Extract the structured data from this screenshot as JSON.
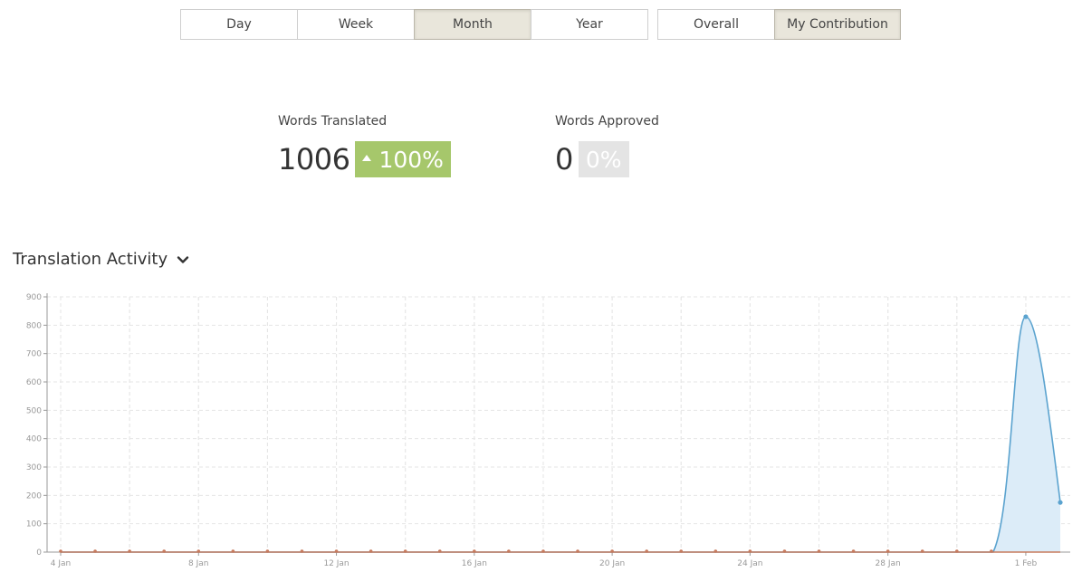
{
  "period_tabs": [
    {
      "label": "Day",
      "active": false
    },
    {
      "label": "Week",
      "active": false
    },
    {
      "label": "Month",
      "active": true
    },
    {
      "label": "Year",
      "active": false
    }
  ],
  "scope_tabs": [
    {
      "label": "Overall",
      "active": false
    },
    {
      "label": "My Contribution",
      "active": true
    }
  ],
  "stats": {
    "translated": {
      "label": "Words Translated",
      "value": "1006",
      "change": "100%",
      "direction": "up"
    },
    "approved": {
      "label": "Words Approved",
      "value": "0",
      "change": "0%",
      "direction": "none"
    }
  },
  "activity": {
    "title": "Translation Activity",
    "toggle_icon": "chevron-down-icon"
  },
  "colors": {
    "active_tab_bg": "#e9e6db",
    "increase_badge": "#a6c76b",
    "neutral_badge": "#e4e4e4",
    "translated_series": "#5ba3cf",
    "translated_fill": "#dcecf8",
    "approved_series": "#c77b5e"
  },
  "chart_data": {
    "type": "area",
    "title": "",
    "xlabel": "",
    "ylabel": "",
    "ylim": [
      0,
      900
    ],
    "yticks": [
      0,
      100,
      200,
      300,
      400,
      500,
      600,
      700,
      800,
      900
    ],
    "x_tick_labels": [
      "4 Jan",
      "8 Jan",
      "12 Jan",
      "16 Jan",
      "20 Jan",
      "24 Jan",
      "28 Jan",
      "1 Feb"
    ],
    "grid": true,
    "x": [
      "4 Jan",
      "5 Jan",
      "6 Jan",
      "7 Jan",
      "8 Jan",
      "9 Jan",
      "10 Jan",
      "11 Jan",
      "12 Jan",
      "13 Jan",
      "14 Jan",
      "15 Jan",
      "16 Jan",
      "17 Jan",
      "18 Jan",
      "19 Jan",
      "20 Jan",
      "21 Jan",
      "22 Jan",
      "23 Jan",
      "24 Jan",
      "25 Jan",
      "26 Jan",
      "27 Jan",
      "28 Jan",
      "29 Jan",
      "30 Jan",
      "31 Jan",
      "1 Feb",
      "2 Feb"
    ],
    "series": [
      {
        "values": [
          0,
          0,
          0,
          0,
          0,
          0,
          0,
          0,
          0,
          0,
          0,
          0,
          0,
          0,
          0,
          0,
          0,
          0,
          0,
          0,
          0,
          0,
          0,
          0,
          0,
          0,
          0,
          0,
          830,
          175
        ]
      },
      {
        "values": [
          0,
          0,
          0,
          0,
          0,
          0,
          0,
          0,
          0,
          0,
          0,
          0,
          0,
          0,
          0,
          0,
          0,
          0,
          0,
          0,
          0,
          0,
          0,
          0,
          0,
          0,
          0,
          0,
          0,
          0
        ]
      }
    ]
  }
}
